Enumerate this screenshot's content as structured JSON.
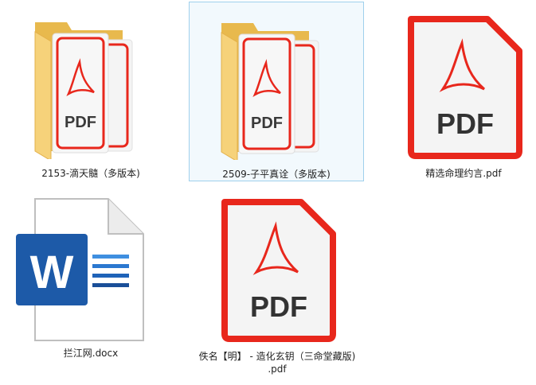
{
  "files": [
    {
      "label": "2153-滴天髓（多版本)",
      "icon": "pdf-folder-icon"
    },
    {
      "label": "2509-子平真诠（多版本)",
      "icon": "pdf-folder-icon"
    },
    {
      "label": "精选命理约言.pdf",
      "icon": "pdf-file-icon"
    },
    {
      "label": "拦江网.docx",
      "icon": "word-document-icon"
    },
    {
      "label_line1": "佚名【明】 - 造化玄钥（三命堂藏版)",
      "label_line2": ".pdf",
      "icon": "pdf-file-icon"
    }
  ],
  "pdf_text": "PDF",
  "word_letter": "W",
  "colors": {
    "pdf_red": "#e8271c",
    "folder_yellow": "#f6d27a",
    "word_blue": "#1d5aa8",
    "selection_bg": "#f2f9fd",
    "selection_border": "#9fd0ec"
  }
}
